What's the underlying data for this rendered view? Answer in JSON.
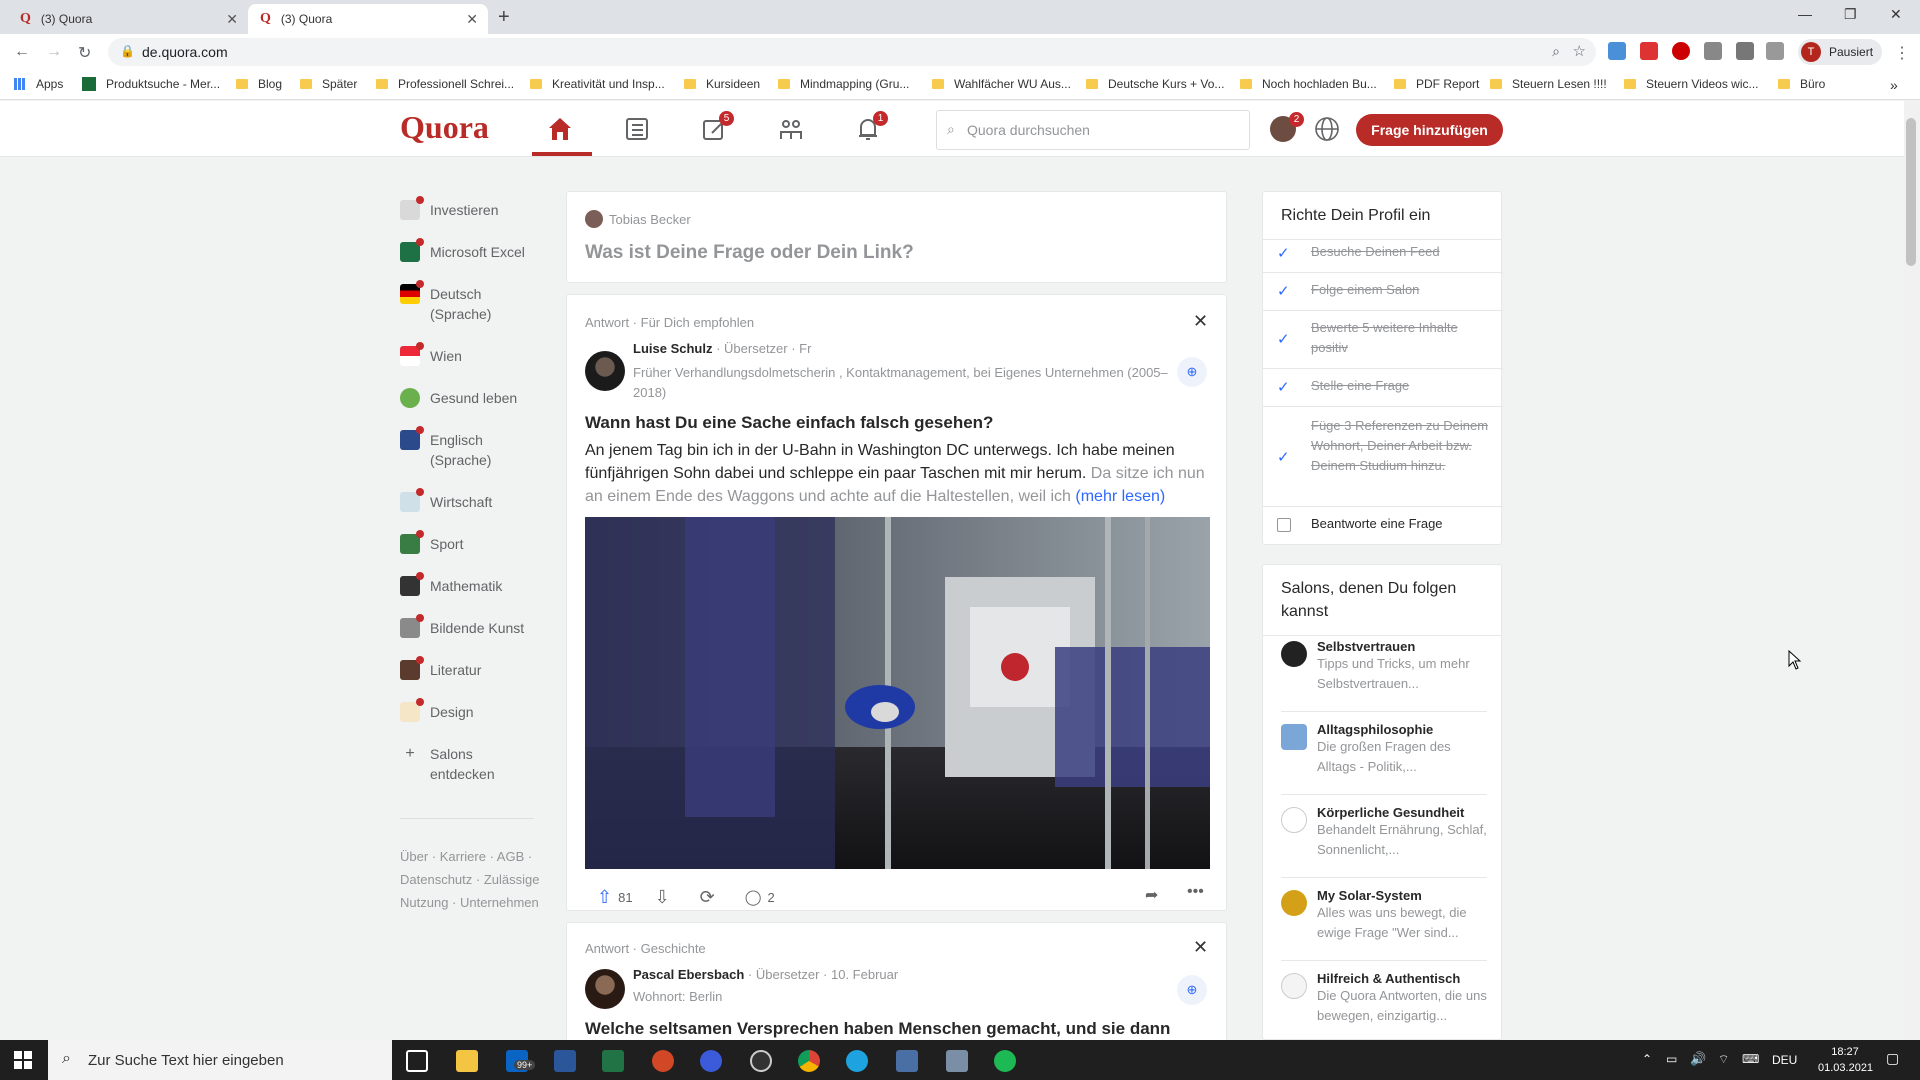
{
  "browser": {
    "tabs": [
      {
        "title": "(3) Quora"
      },
      {
        "title": "(3) Quora"
      }
    ],
    "url": "de.quora.com",
    "profile_status": "Pausiert",
    "bookmarks": [
      "Apps",
      "Produktsuche - Mer...",
      "Blog",
      "Später",
      "Professionell Schrei...",
      "Kreativität und Insp...",
      "Kursideen",
      "Mindmapping (Gru...",
      "Wahlfächer WU Aus...",
      "Deutsche Kurs + Vo...",
      "Noch hochladen Bu...",
      "PDF Report",
      "Steuern Lesen !!!!",
      "Steuern Videos wic...",
      "Büro"
    ]
  },
  "header": {
    "logo": "Quora",
    "answer_badge": "5",
    "notif_badge": "1",
    "profile_badge": "2",
    "search_placeholder": "Quora durchsuchen",
    "ask_button": "Frage hinzufügen"
  },
  "sidebar": {
    "items": [
      {
        "label": "Investieren",
        "color": "#d9d9d9"
      },
      {
        "label": "Microsoft Excel",
        "color": "#1e7145"
      },
      {
        "label": "Deutsch (Sprache)",
        "color": "#000000"
      },
      {
        "label": "Wien",
        "color": "#ed2939"
      },
      {
        "label": "Gesund leben",
        "color": "#6ab04c"
      },
      {
        "label": "Englisch (Sprache)",
        "color": "#2b4a8b"
      },
      {
        "label": "Wirtschaft",
        "color": "#cfe0e8"
      },
      {
        "label": "Sport",
        "color": "#3a7d44"
      },
      {
        "label": "Mathematik",
        "color": "#333333"
      },
      {
        "label": "Bildende Kunst",
        "color": "#8a8a8a"
      },
      {
        "label": "Literatur",
        "color": "#5a3b2e"
      },
      {
        "label": "Design",
        "color": "#f5e6c8"
      }
    ],
    "discover": "Salons entdecken",
    "footer": "Über · Karriere · AGB · Datenschutz · Zulässige Nutzung · Unternehmen"
  },
  "ask_box": {
    "user": "Tobias Becker",
    "prompt": "Was ist Deine Frage oder Dein Link?"
  },
  "post1": {
    "meta": "Antwort · Für Dich empfohlen",
    "author": "Luise Schulz",
    "author_meta": "· Übersetzer · Fr",
    "credential": "Früher Verhandlungsdolmetscherin , Kontaktmanagement, bei Eigenes Unternehmen (2005–2018)",
    "question": "Wann hast Du eine Sache einfach falsch gesehen?",
    "text_main": "An jenem Tag bin ich in der U-Bahn in Washington DC unterwegs. Ich habe meinen fünfjährigen Sohn dabei und schleppe ein paar Taschen mit mir herum. ",
    "text_faded": "Da sitze ich nun an einem Ende des Waggons und achte auf die Haltestellen, weil ich",
    "more": "(mehr lesen)",
    "upvotes": "81",
    "comments": "2"
  },
  "post2": {
    "meta": "Antwort · Geschichte",
    "author": "Pascal Ebersbach",
    "author_meta": "· Übersetzer · 10. Februar",
    "credential": "Wohnort: Berlin",
    "question": "Welche seltsamen Versprechen haben Menschen gemacht, und sie dann"
  },
  "profile_setup": {
    "title": "Richte Dein Profil ein",
    "tasks": [
      "Besuche Deinen Feed",
      "Folge einem Salon",
      "Bewerte 5 weitere Inhalte positiv",
      "Stelle eine Frage",
      "Füge 3 Referenzen zu Deinem Wohnort, Deiner Arbeit bzw. Deinem Studium hinzu."
    ],
    "open_task": "Beantworte eine Frage"
  },
  "salons": {
    "title": "Salons, denen Du folgen kannst",
    "items": [
      {
        "name": "Selbstvertrauen",
        "desc": "Tipps und Tricks, um mehr Selbstvertrauen..."
      },
      {
        "name": "Alltagsphilosophie",
        "desc": "Die großen Fragen des Alltags - Politik,..."
      },
      {
        "name": "Körperliche Gesundheit",
        "desc": "Behandelt Ernährung, Schlaf, Sonnenlicht,..."
      },
      {
        "name": "My Solar-System",
        "desc": "Alles was uns bewegt, die ewige Frage \"Wer sind..."
      },
      {
        "name": "Hilfreich & Authentisch",
        "desc": "Die Quora Antworten, die uns bewegen, einzigartig..."
      }
    ]
  },
  "taskbar": {
    "search_placeholder": "Zur Suche Text hier eingeben",
    "mail_badge": "99+",
    "lang": "DEU",
    "time": "18:27",
    "date": "01.03.2021"
  }
}
